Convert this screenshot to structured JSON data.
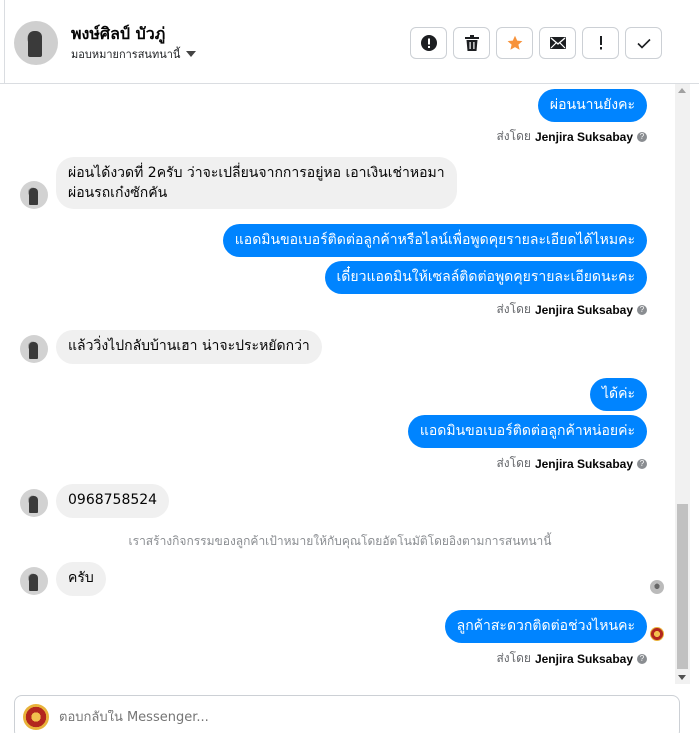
{
  "header": {
    "contact_name": "พงษ์ศิลป์ บัวภู่",
    "assign_label": "มอบหมายการสนทนานี้",
    "actions": [
      {
        "name": "spam",
        "icon": "alert-circle-icon"
      },
      {
        "name": "delete",
        "icon": "trash-icon"
      },
      {
        "name": "star",
        "icon": "star-icon",
        "color": "#f7923a"
      },
      {
        "name": "mail",
        "icon": "envelope-icon"
      },
      {
        "name": "important",
        "icon": "exclamation-icon"
      },
      {
        "name": "done",
        "icon": "checkmark-icon"
      }
    ]
  },
  "agent_name": "Jenjira Suksabay",
  "sent_by_prefix": "ส่งโดย",
  "messages": [
    {
      "dir": "out",
      "text": "ผ่อนนานยังคะ"
    },
    {
      "dir": "in",
      "lines": [
        "ผ่อนได้งวดที่ 2ครับ   ว่าจะเปลี่ยนจากการอยู่หอ   เอาเงินเช่าหอมา",
        "ผ่อนรถเก๋งซักคัน"
      ]
    },
    {
      "dir": "out",
      "text": "แอดมินขอเบอร์ติดต่อลูกค้าหรือไลน์เพื่อพูดคุยรายละเอียดได้ไหมคะ"
    },
    {
      "dir": "out",
      "text": "เดี๋ยวแอดมินให้เซลล์ติดต่อพูดคุยรายละเอียดนะคะ"
    },
    {
      "dir": "in",
      "text": "แล้ววิ่งไปกลับบ้านเฮา  น่าจะประหยัดกว่า"
    },
    {
      "dir": "out",
      "text": "ได้ค่ะ"
    },
    {
      "dir": "out",
      "text": "แอดมินขอเบอร์ติดต่อลูกค้าหน่อยค่ะ"
    },
    {
      "dir": "in",
      "text": "0968758524"
    },
    {
      "dir": "system",
      "text": "เราสร้างกิจกรรมของลูกค้าเป้าหมายให้กับคุณโดยอัตโนมัติโดยอิงตามการสนทนานี้"
    },
    {
      "dir": "in",
      "text": "ครับ"
    },
    {
      "dir": "out",
      "text": "ลูกค้าสะดวกติดต่อช่วงไหนคะ"
    }
  ],
  "composer": {
    "placeholder": "ตอบกลับใน Messenger..."
  },
  "colors": {
    "outgoing_bubble": "#0084ff",
    "incoming_bubble": "#f0f0f0",
    "star": "#f7923a"
  }
}
